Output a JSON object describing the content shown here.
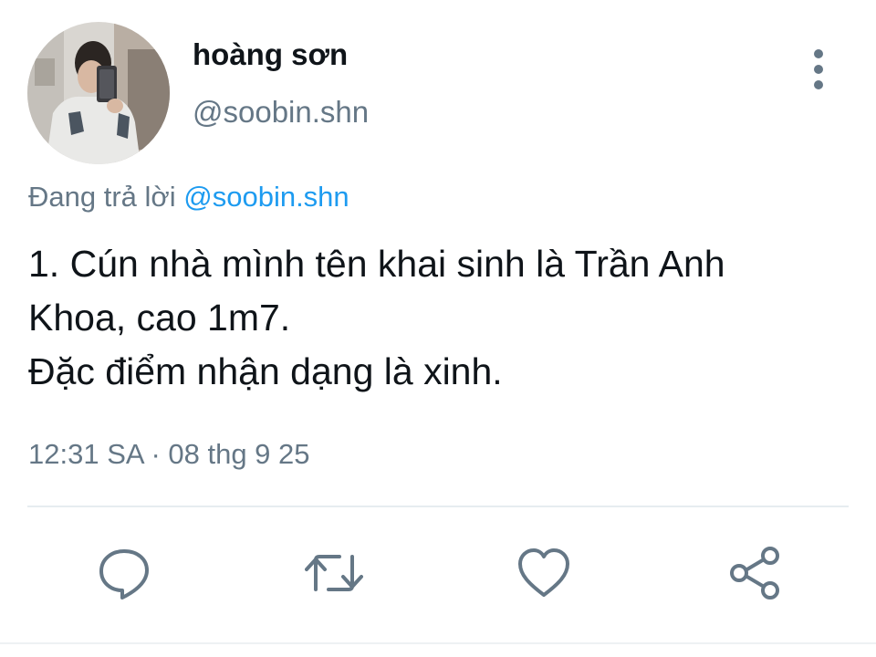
{
  "user": {
    "display_name": "hoàng sơn",
    "handle": "@soobin.shn"
  },
  "reply": {
    "prefix": "Đang trả lời",
    "mention": "@soobin.shn"
  },
  "tweet": {
    "lines": [
      "1. Cún nhà mình tên khai sinh là Trần Anh",
      "Khoa, cao 1m7.",
      "Đặc điểm nhận dạng là xinh."
    ],
    "timestamp": "12:31 SA · 08 thg 9 25"
  },
  "actions": [
    {
      "name": "reply",
      "icon": "reply-icon"
    },
    {
      "name": "retweet",
      "icon": "retweet-icon"
    },
    {
      "name": "like",
      "icon": "heart-icon"
    },
    {
      "name": "share",
      "icon": "share-icon"
    }
  ],
  "colors": {
    "text_primary": "#0f1419",
    "text_secondary": "#657786",
    "accent": "#1d9bf0",
    "divider": "#e6ecf0"
  }
}
